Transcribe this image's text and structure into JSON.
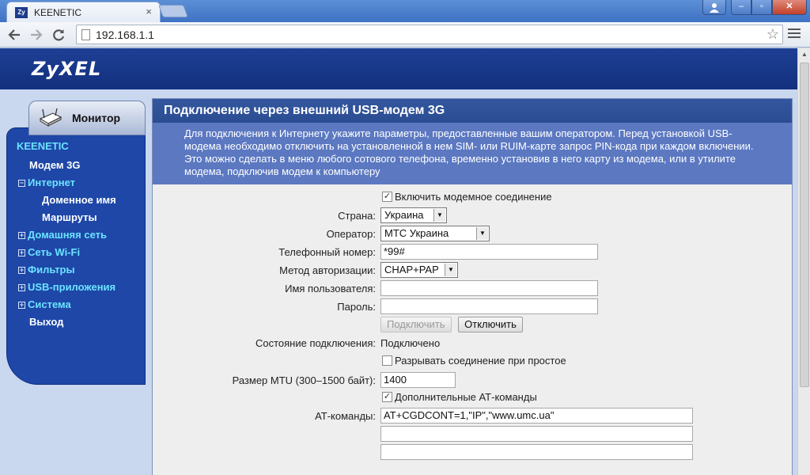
{
  "browser": {
    "tab_title": "KEENETIC",
    "tab_favicon": "Zy",
    "url": "192.168.1.1",
    "icons": [
      "back-icon",
      "forward-icon",
      "reload-icon",
      "star-icon",
      "menu-icon"
    ]
  },
  "header": {
    "logo": "ZyXEL"
  },
  "sidebar": {
    "tab_label": "Монитор",
    "brand": "KEENETIC",
    "items": [
      {
        "label": "Модем 3G",
        "level": 1,
        "expander": "",
        "color": "white"
      },
      {
        "label": "Интернет",
        "level": 0,
        "expander": "−",
        "color": "cyan"
      },
      {
        "label": "Доменное имя",
        "level": 2,
        "expander": "",
        "color": "white"
      },
      {
        "label": "Маршруты",
        "level": 2,
        "expander": "",
        "color": "white"
      },
      {
        "label": "Домашняя сеть",
        "level": 0,
        "expander": "+",
        "color": "cyan"
      },
      {
        "label": "Сеть Wi-Fi",
        "level": 0,
        "expander": "+",
        "color": "cyan"
      },
      {
        "label": "Фильтры",
        "level": 0,
        "expander": "+",
        "color": "cyan"
      },
      {
        "label": "USB-приложения",
        "level": 0,
        "expander": "+",
        "color": "cyan"
      },
      {
        "label": "Система",
        "level": 0,
        "expander": "+",
        "color": "cyan"
      },
      {
        "label": "Выход",
        "level": 1,
        "expander": "",
        "color": "white"
      }
    ]
  },
  "main": {
    "title": "Подключение через внешний USB-модем 3G",
    "description": "Для подключения к Интернету укажите параметры, предоставленные вашим оператором. Перед установкой USB-модема необходимо отключить на установленной в нем SIM- или RUIM-карте запрос PIN-кода при каждом включении. Это можно сделать в меню любого сотового телефона, временно установив в него карту из модема, или в утилите модема, подключив модем к компьютеру",
    "enable_modem_label": "Включить модемное соединение",
    "country_label": "Страна:",
    "country_value": "Украина",
    "operator_label": "Оператор:",
    "operator_value": "МТС Украина",
    "phone_label": "Телефонный номер:",
    "phone_value": "*99#",
    "auth_label": "Метод авторизации:",
    "auth_value": "CHAP+PAP",
    "username_label": "Имя пользователя:",
    "username_value": "",
    "password_label": "Пароль:",
    "password_value": "",
    "connect_button": "Подключить",
    "disconnect_button": "Отключить",
    "status_label": "Состояние подключения:",
    "status_value": "Подключено",
    "idle_disconnect_label": "Разрывать соединение при простое",
    "mtu_label": "Размер MTU (300–1500 байт):",
    "mtu_value": "1400",
    "at_extra_label": "Дополнительные АТ-команды",
    "at_label": "АТ-команды:",
    "at_values": [
      "AT+CGDCONT=1,\"IP\",\"www.umc.ua\"",
      "",
      ""
    ]
  }
}
